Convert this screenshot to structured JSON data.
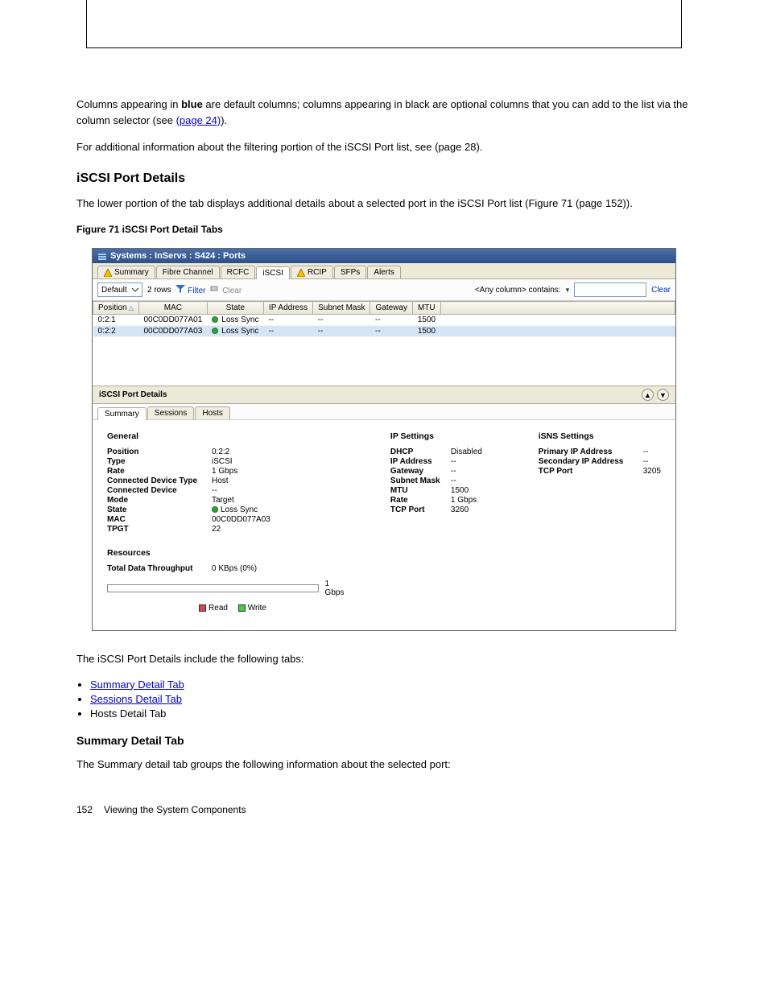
{
  "top_table": {
    "c1": "",
    "c2": "",
    "c3": ""
  },
  "intro": {
    "p1a": "Columns appearing in ",
    "p1b": "blue",
    "p1c": " are default columns; columns appearing in black are optional columns that you can add to the list via the column selector (see ",
    "p1link": "(page 24)",
    "p1d": ").",
    "p2": "For additional information about the filtering portion of the iSCSI Port list, see (page 28)."
  },
  "sec1_title": "iSCSI Port Details",
  "sec1_p": "The lower portion of the tab displays additional details about a selected port in the iSCSI Port list (Figure 71 (page 152)).",
  "fig_label": "Figure 71 iSCSI Port Detail Tabs",
  "window": {
    "title": "Systems : InServs : S424 : Ports",
    "tabs": [
      "Summary",
      "Fibre Channel",
      "RCFC",
      "iSCSI",
      "RCIP",
      "SFPs",
      "Alerts"
    ],
    "active_tab": 3,
    "warn_tabs": [
      0,
      4
    ],
    "toolbar": {
      "default": "Default",
      "rows": "2 rows",
      "filter": "Filter",
      "clear": "Clear",
      "contains": "<Any column> contains:",
      "clear2": "Clear"
    },
    "headers": [
      "Position",
      "MAC",
      "State",
      "IP Address",
      "Subnet Mask",
      "Gateway",
      "MTU"
    ],
    "rows": [
      {
        "pos": "0:2:1",
        "mac": "00C0DD077A01",
        "state": "Loss Sync",
        "ip": "--",
        "mask": "--",
        "gw": "--",
        "mtu": "1500",
        "sel": false
      },
      {
        "pos": "0:2:2",
        "mac": "00C0DD077A03",
        "state": "Loss Sync",
        "ip": "--",
        "mask": "--",
        "gw": "--",
        "mtu": "1500",
        "sel": true
      }
    ],
    "details_title": "iSCSI Port Details",
    "sub_tabs": [
      "Summary",
      "Sessions",
      "Hosts"
    ],
    "sub_active": 0,
    "general": {
      "title": "General",
      "items": [
        {
          "k": "Position",
          "v": "0:2:2"
        },
        {
          "k": "Type",
          "v": "iSCSI"
        },
        {
          "k": "Rate",
          "v": "1 Gbps"
        },
        {
          "k": "Connected Device Type",
          "v": "Host"
        },
        {
          "k": "Connected Device",
          "v": "--"
        },
        {
          "k": "Mode",
          "v": "Target"
        },
        {
          "k": "State",
          "v": "Loss Sync",
          "dot": true
        },
        {
          "k": "MAC",
          "v": "00C0DD077A03"
        },
        {
          "k": "TPGT",
          "v": "22"
        }
      ]
    },
    "ip": {
      "title": "IP Settings",
      "items": [
        {
          "k": "DHCP",
          "v": "Disabled"
        },
        {
          "k": "IP Address",
          "v": "--"
        },
        {
          "k": "Gateway",
          "v": "--"
        },
        {
          "k": "Subnet Mask",
          "v": "--"
        },
        {
          "k": "MTU",
          "v": "1500"
        },
        {
          "k": "Rate",
          "v": "1 Gbps"
        },
        {
          "k": "TCP Port",
          "v": "3260"
        }
      ]
    },
    "isns": {
      "title": "iSNS Settings",
      "items": [
        {
          "k": "Primary IP Address",
          "v": "--"
        },
        {
          "k": "Secondary IP Address",
          "v": "--"
        },
        {
          "k": "TCP Port",
          "v": "3205"
        }
      ]
    },
    "resources": {
      "title": "Resources",
      "k": "Total Data Throughput",
      "v": "0 KBps (0%)",
      "max": "1 Gbps",
      "read": "Read",
      "write": "Write"
    }
  },
  "after": {
    "p": "The iSCSI Port Details include the following tabs:",
    "bullets": [
      "Summary Detail Tab",
      "Sessions Detail Tab",
      "Hosts Detail Tab"
    ]
  },
  "sub_section": {
    "title": "Summary Detail Tab",
    "p": "The Summary detail tab groups the following information about the selected port:"
  },
  "footer": {
    "left": "152",
    "right": "Viewing the System Components"
  }
}
